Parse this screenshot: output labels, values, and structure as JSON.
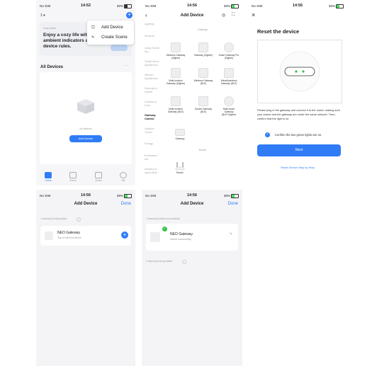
{
  "p1": {
    "status": {
      "carrier": "No SIM",
      "time": "14:52",
      "battery": "38%"
    },
    "home_label": "1",
    "card": {
      "small": "Cozy Home",
      "text": "Enjoy a cozy life with ambient indicators and device rules."
    },
    "menu": {
      "add_device": "Add Device",
      "create_scene": "Create Scene"
    },
    "all_devices": "All Devices",
    "more": "···",
    "empty_text": "No devices",
    "add_button": "Add Device",
    "nav": [
      "Home",
      "Scene",
      "Smart",
      "Me"
    ]
  },
  "p2": {
    "status": {
      "carrier": "No SIM",
      "time": "14:56",
      "battery": "38%"
    },
    "title": "Add Device",
    "categories": [
      "Lighting",
      "Sensors",
      "Large Home Ap...",
      "Small Home Appliances",
      "Kitchen Appliances",
      "Exercise & Health",
      "Camera & Lock",
      "Gateway Control",
      "Outdoor Travel",
      "Energy",
      "Entertainm ent",
      "Industry & Agriculture"
    ],
    "gateway_heading": "Gateway",
    "router_heading": "Router",
    "devices": [
      "Wireless Gateway (Zigbee)",
      "Gateway (Zigbee)",
      "Smart Gateway Pro (Zigbee)",
      "Multi-function Gateway (Zigbee)",
      "Wireless Gateway (BLE)",
      "Wired&wireless Gateway (BLE)",
      "Multi-function Gateway (BLE)",
      "Socket Gateway (BLE)",
      "Multi-mode Gateway (BLE+Zigbee)",
      "Gateway"
    ],
    "router": "Router"
  },
  "p3": {
    "status": {
      "carrier": "No SIM",
      "time": "14:56",
      "battery": "38%"
    },
    "close": "×",
    "title": "Reset the device",
    "description": "Please plug in the gateway and connect it to the router, making sure your phone and the gateway are under the same network. Then, confirm that the light is on.",
    "confirm": "Confirm the two green lights are on.",
    "next": "Next",
    "reset_link": "Reset Device Step by Step",
    "colors": {
      "accent": "#2f7cf6",
      "led": "#36c04a"
    }
  },
  "p4": {
    "status": {
      "carrier": "No SIM",
      "time": "14:56",
      "battery": "38%"
    },
    "title": "Add Device",
    "done": "Done",
    "being_added": "1 device(s) being added",
    "device_name": "NEO Gateway",
    "device_sub": "Tap to edit this device"
  },
  "p5": {
    "status": {
      "carrier": "No SIM",
      "time": "14:56",
      "battery": "38%"
    },
    "title": "Add Device",
    "done": "Done",
    "added": "1 device(s) added successfully",
    "device_name": "NEO Gateway",
    "device_sub": "Added successfully",
    "being_added": "0 device(s) being added"
  }
}
